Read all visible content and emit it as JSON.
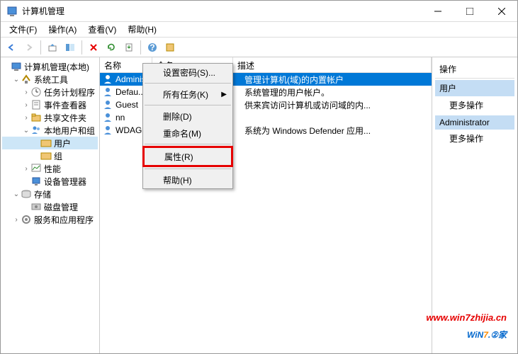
{
  "window": {
    "title": "计算机管理"
  },
  "menubar": {
    "file": "文件(F)",
    "action": "操作(A)",
    "view": "查看(V)",
    "help": "帮助(H)"
  },
  "tree": {
    "root": "计算机管理(本地)",
    "systools": "系统工具",
    "task": "任务计划程序",
    "event": "事件查看器",
    "shared": "共享文件夹",
    "localug": "本地用户和组",
    "users": "用户",
    "groups": "组",
    "perf": "性能",
    "devmgr": "设备管理器",
    "storage": "存储",
    "disk": "磁盘管理",
    "services": "服务和应用程序"
  },
  "listhdr": {
    "name": "名称",
    "fullname": "全名",
    "desc": "描述"
  },
  "rows": [
    {
      "name": "Administrator",
      "full": "",
      "desc": "管理计算机(域)的内置帐户"
    },
    {
      "name": "Defau...",
      "full": "",
      "desc": "系统管理的用户帐户。"
    },
    {
      "name": "Guest",
      "full": "",
      "desc": "供来宾访问计算机或访问域的内..."
    },
    {
      "name": "nn",
      "full": "",
      "desc": ""
    },
    {
      "name": "WDAG...",
      "full": "",
      "desc": "系统为 Windows Defender 应用..."
    }
  ],
  "ctx": {
    "setpwd": "设置密码(S)...",
    "alltasks": "所有任务(K)",
    "delete": "删除(D)",
    "rename": "重命名(M)",
    "props": "属性(R)",
    "help": "帮助(H)"
  },
  "actions": {
    "hdr": "操作",
    "sec1": "用户",
    "more1": "更多操作",
    "sec2": "Administrator",
    "more2": "更多操作"
  },
  "watermark": {
    "url": "www.win7zhijia.cn",
    "brand1": "WiN",
    "brand2": "7",
    "brand3": ".②家"
  }
}
